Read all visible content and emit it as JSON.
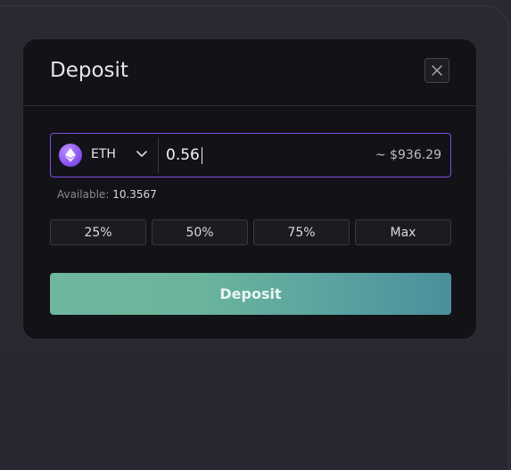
{
  "modal": {
    "title": "Deposit"
  },
  "token": {
    "symbol": "ETH",
    "icon": "ethereum-icon"
  },
  "amount": {
    "value": "0.56",
    "usd_estimate": "~ $936.29"
  },
  "available": {
    "label": "Available:",
    "value": "10.3567"
  },
  "percent_buttons": [
    {
      "label": "25%"
    },
    {
      "label": "50%"
    },
    {
      "label": "75%"
    },
    {
      "label": "Max"
    }
  ],
  "actions": {
    "deposit_label": "Deposit"
  },
  "colors": {
    "accent_border": "#7b4fe0",
    "button_gradient_start": "#6fb79d",
    "button_gradient_end": "#4a8f9c"
  }
}
